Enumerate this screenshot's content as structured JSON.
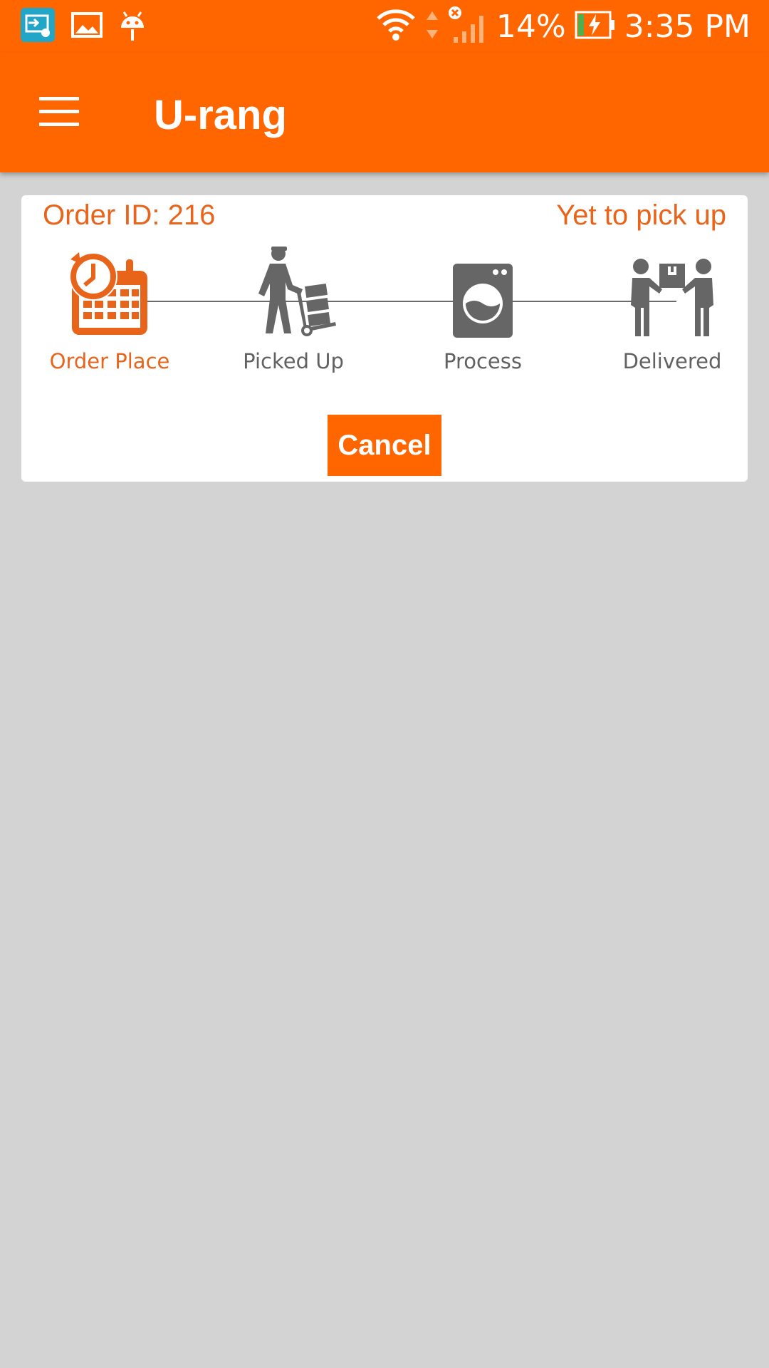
{
  "status_bar": {
    "battery": "14%",
    "time": "3:35 PM",
    "left_icons": [
      "cast-icon",
      "image-icon",
      "android-debug-icon"
    ],
    "right_icons": [
      "wifi-icon",
      "data-arrows-icon",
      "signal-icon",
      "battery-charging-icon"
    ]
  },
  "app_bar": {
    "title": "U-rang",
    "menu_icon": "hamburger-menu-icon"
  },
  "order": {
    "id_label": "Order ID: 216",
    "status": "Yet to pick up",
    "steps": [
      {
        "label": "Order Place",
        "icon": "calendar-clock-icon",
        "active": true
      },
      {
        "label": "Picked Up",
        "icon": "delivery-person-trolley-icon",
        "active": false
      },
      {
        "label": "Process",
        "icon": "washing-machine-icon",
        "active": false
      },
      {
        "label": "Delivered",
        "icon": "package-handover-icon",
        "active": false
      }
    ],
    "cancel_label": "Cancel"
  },
  "colors": {
    "primary": "#ff6600",
    "accent_text": "#e8641b",
    "inactive": "#616161",
    "background": "#d3d3d3",
    "card": "#ffffff"
  }
}
